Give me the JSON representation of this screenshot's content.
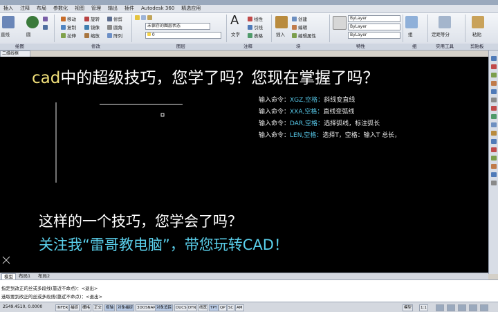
{
  "menu": {
    "tabs": [
      "插入",
      "注释",
      "布局",
      "参数化",
      "视图",
      "管理",
      "输出",
      "插件",
      "Autodesk 360",
      "精选应用"
    ]
  },
  "ribbon": {
    "draw": {
      "line": "直线",
      "polyline": "多段线",
      "circle": "圆",
      "arc": "圆弧"
    },
    "modify": {
      "move": "移动",
      "copy": "复制",
      "stretch": "拉伸",
      "rotate": "旋转",
      "mirror": "镜像",
      "scale": "缩放",
      "trim": "修剪",
      "fillet": "圆角",
      "array": "阵列"
    },
    "layer": {
      "state": "未保存的图层状态",
      "current": "0"
    },
    "annotation": {
      "text": "文字",
      "dimension": "线性",
      "leader": "引线",
      "table": "表格"
    },
    "block": {
      "insert": "插入",
      "create": "创建",
      "edit": "编辑",
      "edit_attr": "编辑属性"
    },
    "properties": {
      "color": "ByLayer",
      "linetype": "ByLayer",
      "lineweight": "ByLayer"
    },
    "groups": {
      "group": "组"
    },
    "utilities": {
      "measure": "定距等分"
    },
    "clipboard": {
      "paste": "粘贴"
    }
  },
  "panels": [
    "绘图",
    "修改",
    "图层",
    "注释",
    "块",
    "特性",
    "组",
    "实用工具",
    "剪贴板"
  ],
  "drawing_tab": "二维线框",
  "canvas": {
    "headline_highlight": "cad",
    "headline_rest": "中的超级技巧，您学了吗？您现在掌握了吗？",
    "commands": [
      {
        "prefix": "输入命令：",
        "kw": "XGZ,空格：",
        "desc": "斜线变直线"
      },
      {
        "prefix": "输入命令：",
        "kw": "XXA,空格：",
        "desc": "直线变弧线"
      },
      {
        "prefix": "输入命令：",
        "kw": "DAR,空格：",
        "desc": "选择弧线，标注弧长"
      },
      {
        "prefix": "输入命令：",
        "kw": "LEN,空格：",
        "desc": "选择T，空格：输入T 总长，"
      }
    ],
    "question": "这样的一个技巧，您学会了吗？",
    "follow": "关注我“雷哥教电脑”，带您玩转CAD！"
  },
  "layout_tabs": [
    "模型",
    "布局1",
    "布局2"
  ],
  "command_lines": [
    "指定到改正的丝或多段线(靠近不命点)：<退出>",
    "选取要到改正的丝或多段线(靠近不命点)：<退出>"
  ],
  "status": {
    "coords": "2549.4510, 0.0000",
    "toggles": [
      "INFER",
      "捕捉",
      "栅格",
      "正交",
      "极轴",
      "对象捕捉",
      "3DOSNAP",
      "对象追踪",
      "DUCS",
      "DYN",
      "线宽",
      "TPY",
      "QP",
      "SC",
      "AM"
    ],
    "model_label": "模型",
    "scale": "1:1"
  },
  "colors": {
    "canvas": "#000000",
    "cyan": "#56c6e6",
    "yellow": "#f1e07a"
  }
}
